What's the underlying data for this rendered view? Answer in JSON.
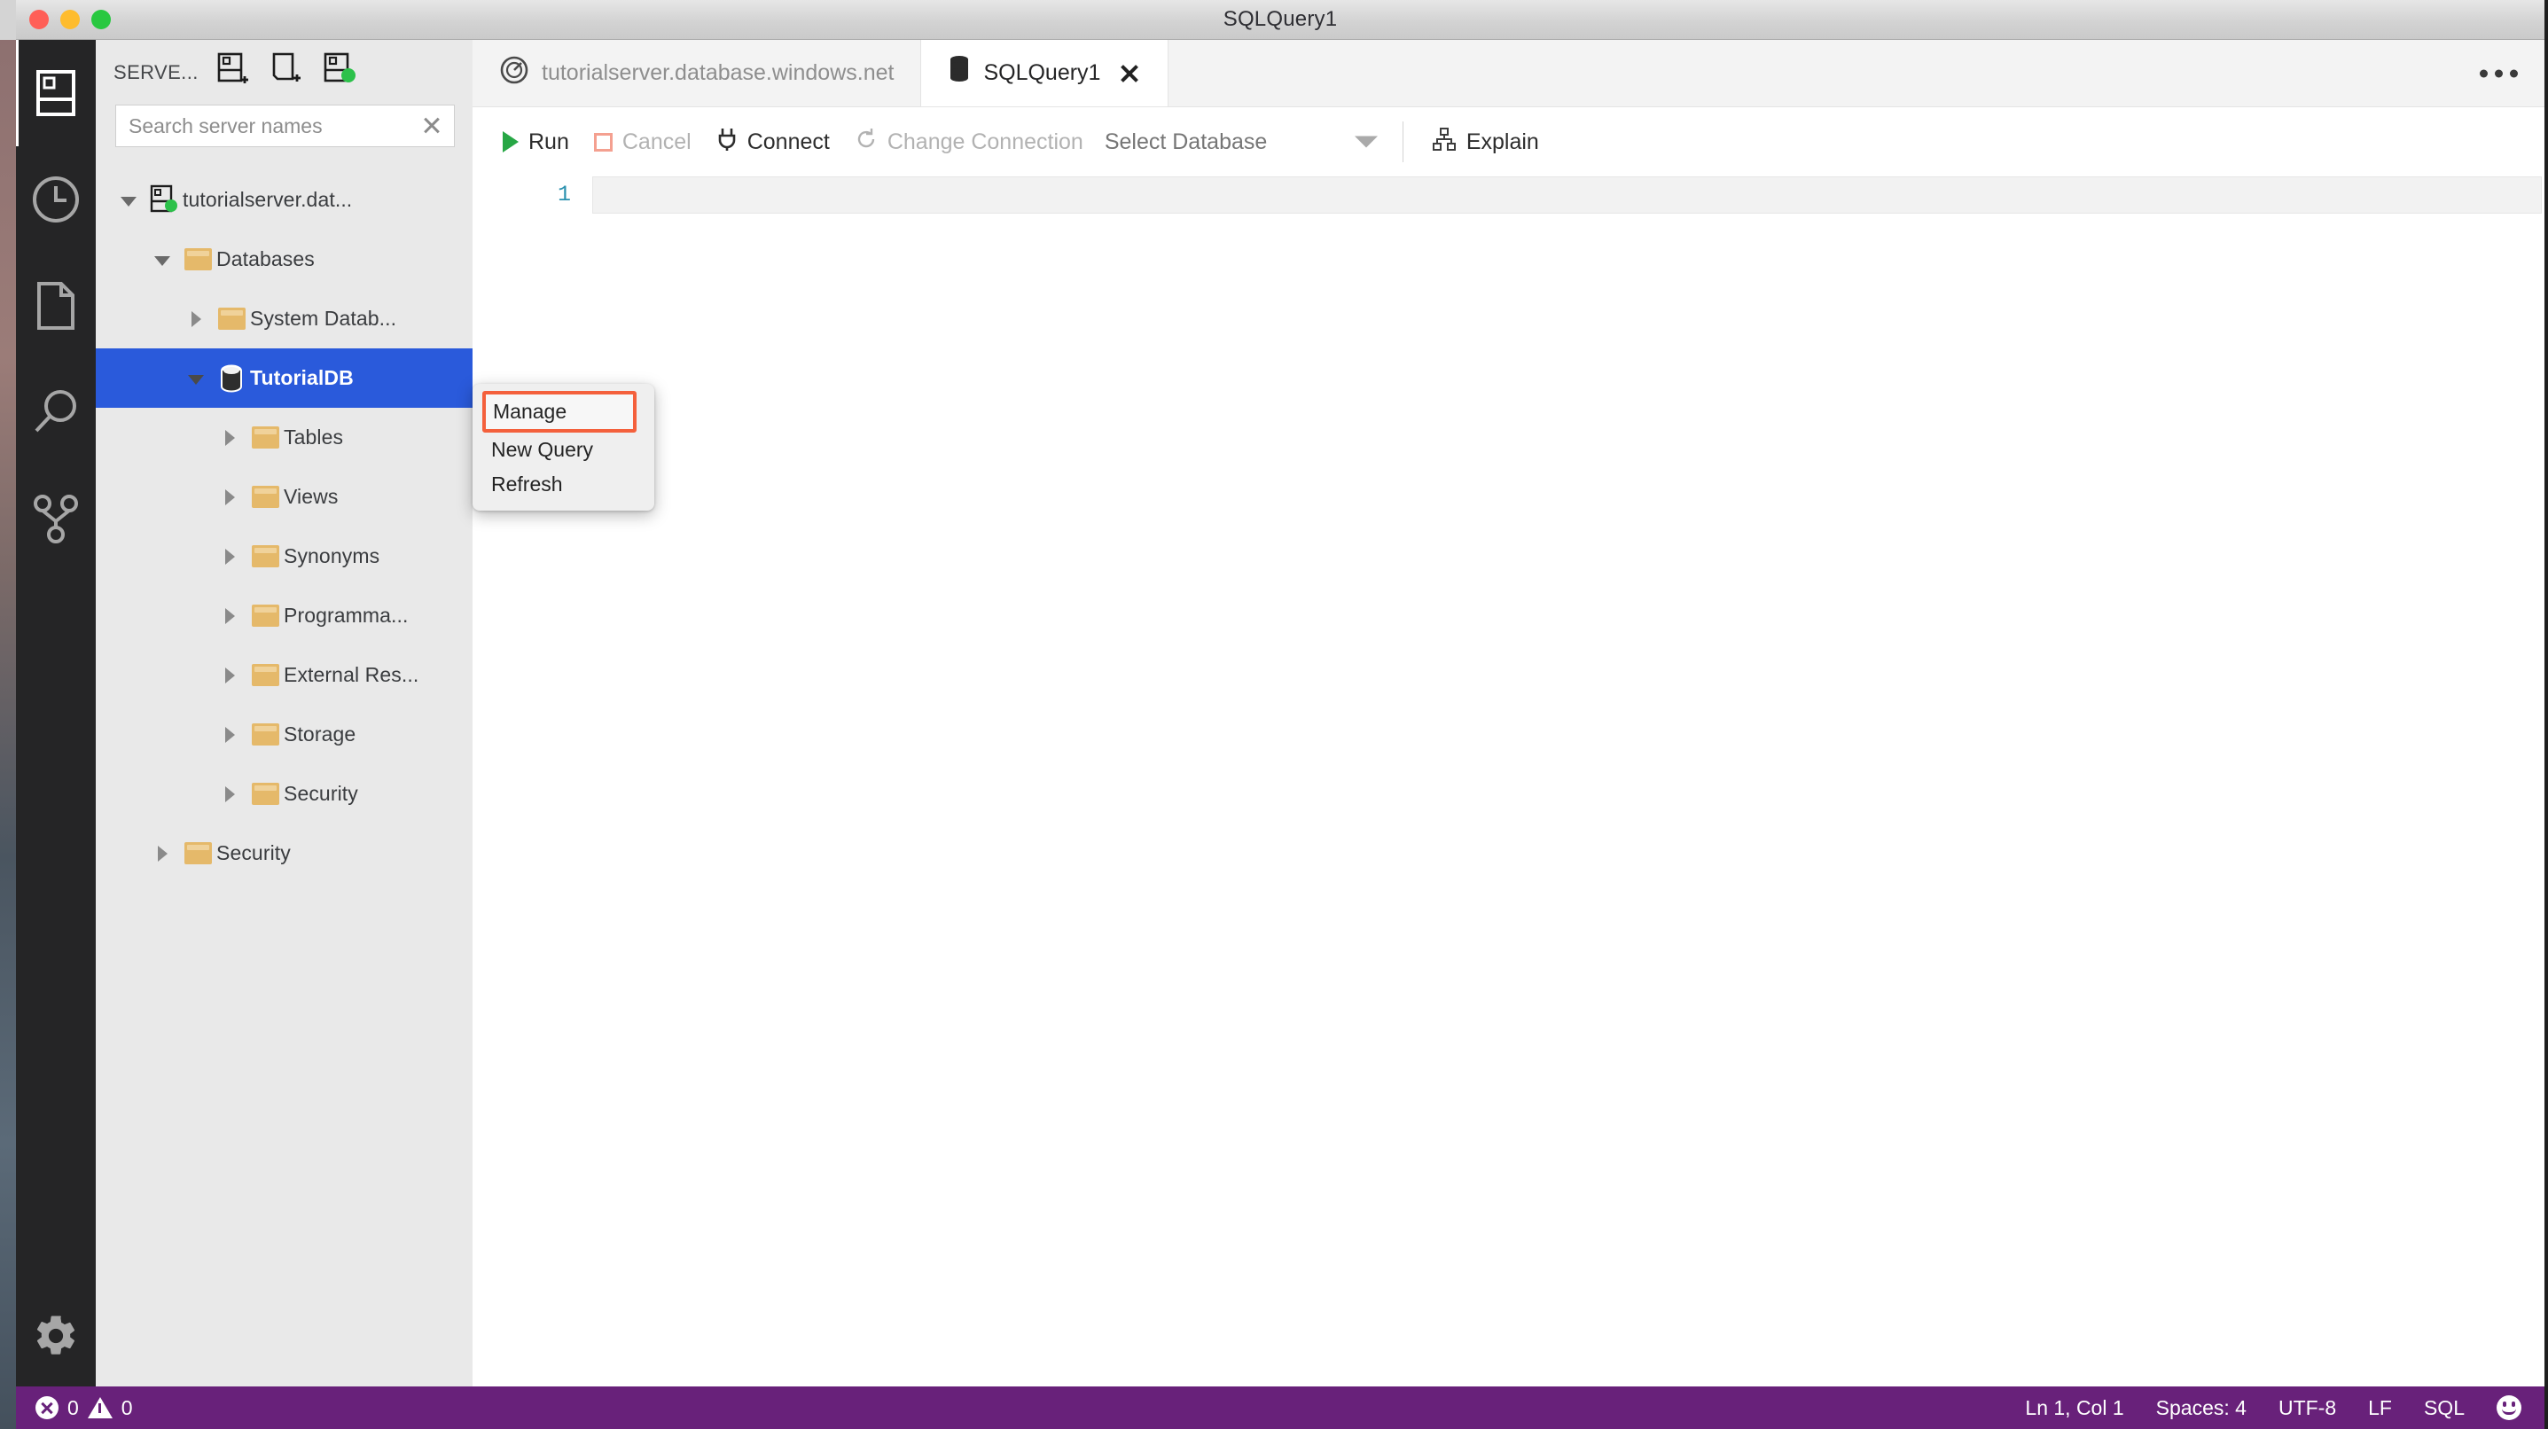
{
  "window": {
    "title": "SQLQuery1",
    "traffic_lights": [
      "close-red",
      "minimize-yellow",
      "zoom-green"
    ]
  },
  "activity_bar": {
    "items": [
      {
        "name": "servers-icon",
        "label": "Servers",
        "active": true
      },
      {
        "name": "history-icon",
        "label": "History",
        "active": false
      },
      {
        "name": "file-icon",
        "label": "Explorer",
        "active": false
      },
      {
        "name": "search-icon",
        "label": "Search",
        "active": false
      },
      {
        "name": "source-control-icon",
        "label": "Source Control",
        "active": false
      }
    ],
    "bottom": {
      "name": "gear-icon",
      "label": "Manage"
    }
  },
  "sidebar": {
    "title": "SERVE...",
    "actions": [
      {
        "name": "add-connection-icon",
        "label": "New Connection"
      },
      {
        "name": "new-server-group-icon",
        "label": "New Server Group"
      },
      {
        "name": "connected-server-icon",
        "label": "Show Active Connections"
      }
    ],
    "search": {
      "placeholder": "Search server names",
      "value": "",
      "clear_label": "Clear"
    },
    "tree": [
      {
        "label": "tutorialserver.dat...",
        "icon": "server-connected-icon",
        "depth": 0,
        "twisty": "open",
        "selected": false
      },
      {
        "label": "Databases",
        "icon": "folder-icon",
        "depth": 1,
        "twisty": "open",
        "selected": false
      },
      {
        "label": "System Datab...",
        "icon": "folder-icon",
        "depth": 2,
        "twisty": "closed",
        "selected": false
      },
      {
        "label": "TutorialDB",
        "icon": "database-icon",
        "depth": 2,
        "twisty": "open",
        "selected": true
      },
      {
        "label": "Tables",
        "icon": "folder-icon",
        "depth": 3,
        "twisty": "closed",
        "selected": false
      },
      {
        "label": "Views",
        "icon": "folder-icon",
        "depth": 3,
        "twisty": "closed",
        "selected": false
      },
      {
        "label": "Synonyms",
        "icon": "folder-icon",
        "depth": 3,
        "twisty": "closed",
        "selected": false
      },
      {
        "label": "Programma...",
        "icon": "folder-icon",
        "depth": 3,
        "twisty": "closed",
        "selected": false
      },
      {
        "label": "External Res...",
        "icon": "folder-icon",
        "depth": 3,
        "twisty": "closed",
        "selected": false
      },
      {
        "label": "Storage",
        "icon": "folder-icon",
        "depth": 3,
        "twisty": "closed",
        "selected": false
      },
      {
        "label": "Security",
        "icon": "folder-icon",
        "depth": 3,
        "twisty": "closed",
        "selected": false
      },
      {
        "label": "Security",
        "icon": "folder-icon",
        "depth": 1,
        "twisty": "closed",
        "selected": false
      }
    ]
  },
  "context_menu": {
    "items": [
      {
        "label": "Manage",
        "highlighted": true
      },
      {
        "label": "New Query",
        "highlighted": false
      },
      {
        "label": "Refresh",
        "highlighted": false
      }
    ],
    "highlight_color": "#f4603c"
  },
  "tabs": [
    {
      "label": "tutorialserver.database.windows.net",
      "icon": "dashboard-icon",
      "active": false,
      "closable": false
    },
    {
      "label": "SQLQuery1",
      "icon": "database-icon",
      "active": true,
      "closable": true
    }
  ],
  "tabbar": {
    "more_label": "More Actions..."
  },
  "query_toolbar": {
    "run": "Run",
    "cancel": "Cancel",
    "connect": "Connect",
    "change_connection": "Change Connection",
    "select_database": "Select Database",
    "explain": "Explain"
  },
  "editor": {
    "lines": [
      {
        "number": "1",
        "text": ""
      }
    ]
  },
  "status_bar": {
    "errors": "0",
    "warnings": "0",
    "cursor": "Ln 1, Col 1",
    "indentation": "Spaces: 4",
    "encoding": "UTF-8",
    "eol": "LF",
    "language": "SQL",
    "feedback": "feedback-smiley",
    "background": "#68217a"
  }
}
